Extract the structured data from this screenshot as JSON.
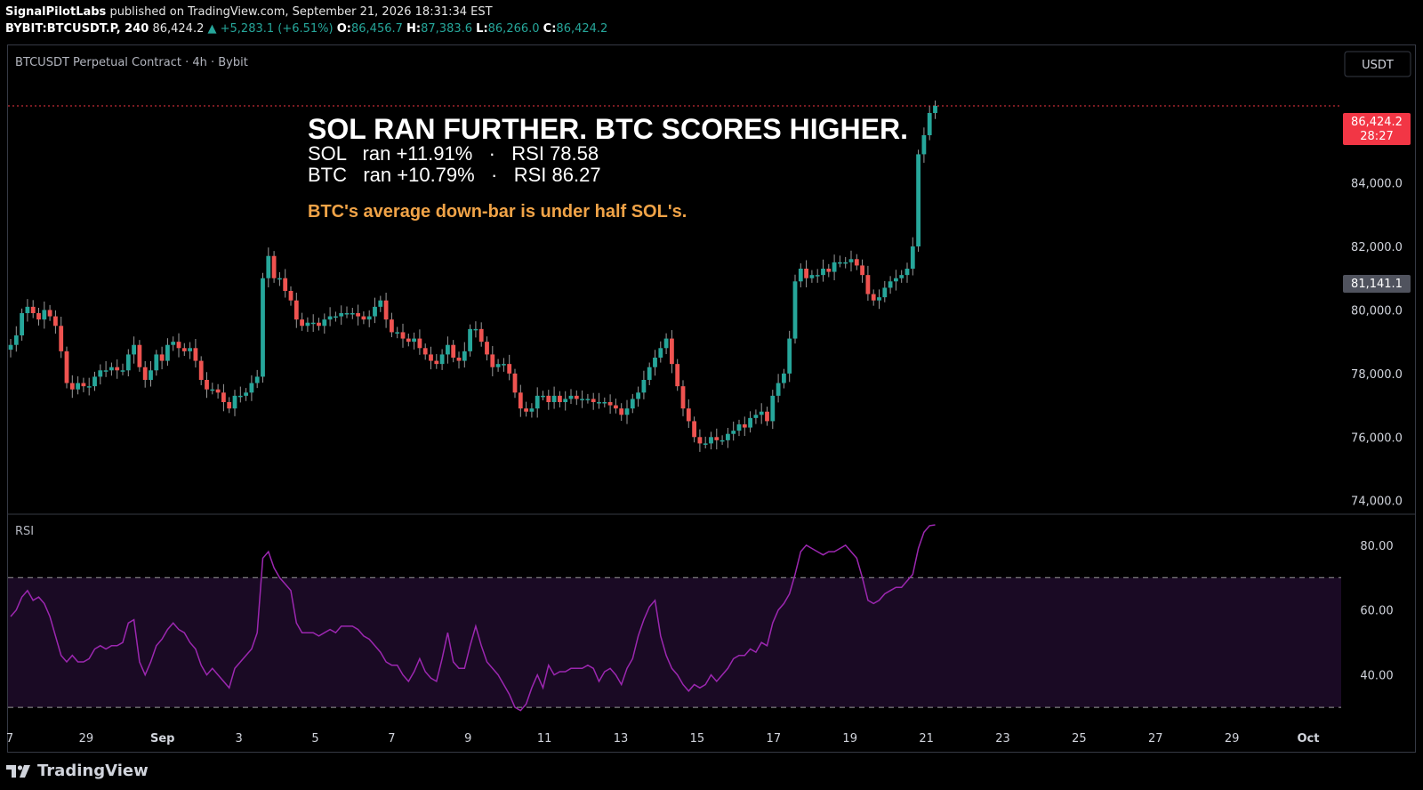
{
  "header": {
    "publisher": "SignalPilotLabs",
    "published_text": "published on TradingView.com, September 21, 2026 18:31:34 EST",
    "symbol": "BYBIT:BTCUSDT.P, 240",
    "last": "86,424.2",
    "change": "▲ +5,283.1 (+6.51%)",
    "o_label": "O:",
    "o": "86,456.7",
    "h_label": "H:",
    "h": "87,383.6",
    "l_label": "L:",
    "l": "86,266.0",
    "c_label": "C:",
    "c": "86,424.2"
  },
  "pane": {
    "legend": "BTCUSDT Perpetual Contract · 4h · Bybit",
    "currency_button": "USDT",
    "rsi_label": "RSI"
  },
  "annotation": {
    "headline": "SOL RAN FURTHER. BTC SCORES HIGHER.",
    "line1": "SOL   ran +11.91%   ·   RSI 78.58",
    "line2": "BTC   ran +10.79%   ·   RSI 86.27",
    "note": "BTC's average down-bar is under half SOL's."
  },
  "price_tags": {
    "last_price": "86,424.2",
    "countdown": "28:27",
    "prev_close": "81,141.1"
  },
  "footer": {
    "brand": "TradingView"
  },
  "chart_data": [
    {
      "type": "candlestick",
      "title": "BTCUSDT Perpetual Contract · 4h · Bybit",
      "ylim": [
        73600,
        88300
      ],
      "y_ticks": [
        74000,
        76000,
        78000,
        80000,
        82000,
        84000
      ],
      "y_tick_labels": [
        "74,000.0",
        "76,000.0",
        "78,000.0",
        "80,000.0",
        "82,000.0",
        "84,000.0"
      ],
      "x_tick_labels": [
        "7",
        "29",
        "Sep",
        "3",
        "5",
        "7",
        "9",
        "11",
        "13",
        "15",
        "17",
        "19",
        "21",
        "23",
        "25",
        "27",
        "29",
        "Oct"
      ],
      "close_series": [
        78900,
        79200,
        79900,
        80100,
        79900,
        79700,
        80000,
        79800,
        79500,
        78700,
        77700,
        77500,
        77700,
        77600,
        77600,
        77900,
        78100,
        78100,
        78200,
        78100,
        78100,
        78600,
        78900,
        78200,
        77800,
        78100,
        78600,
        78400,
        78900,
        79000,
        78800,
        78700,
        78800,
        78400,
        77800,
        77500,
        77500,
        77400,
        77100,
        76900,
        77300,
        77300,
        77400,
        77700,
        77900,
        81000,
        81700,
        81000,
        81000,
        80600,
        80300,
        79700,
        79500,
        79600,
        79600,
        79500,
        79700,
        79800,
        79800,
        79900,
        79900,
        79900,
        79800,
        79700,
        79800,
        80100,
        80300,
        79700,
        79300,
        79300,
        79100,
        79000,
        79100,
        78800,
        78600,
        78400,
        78300,
        78600,
        78900,
        78500,
        78400,
        78700,
        79400,
        79400,
        79000,
        78600,
        78200,
        78300,
        78300,
        78000,
        77400,
        76900,
        76800,
        76900,
        77300,
        77300,
        77100,
        77300,
        77100,
        77200,
        77300,
        77200,
        77200,
        77200,
        77100,
        77100,
        77100,
        77000,
        76900,
        76700,
        76900,
        77200,
        77400,
        77800,
        78200,
        78500,
        78800,
        79100,
        78300,
        77600,
        76900,
        76500,
        76000,
        75800,
        75800,
        76000,
        75900,
        75900,
        76100,
        76200,
        76400,
        76300,
        76600,
        76700,
        76800,
        76500,
        77300,
        77700,
        78000,
        79100,
        80900,
        81300,
        81000,
        81100,
        81100,
        81300,
        81200,
        81500,
        81500,
        81500,
        81600,
        81400,
        81100,
        80500,
        80300,
        80400,
        80700,
        80900,
        81000,
        81100,
        81300,
        82000,
        84900,
        85500,
        86200,
        86424.2
      ],
      "last_price": 86424.2
    },
    {
      "type": "line",
      "title": "RSI",
      "ylim": [
        27,
        89
      ],
      "y_ticks": [
        40,
        60,
        80
      ],
      "y_tick_labels": [
        "40.00",
        "60.00",
        "80.00"
      ],
      "bands": [
        30,
        70
      ],
      "values": [
        58,
        60,
        64,
        66,
        63,
        64,
        62,
        58,
        52,
        46,
        44,
        46,
        44,
        44,
        45,
        48,
        49,
        48,
        49,
        49,
        50,
        56,
        57,
        44,
        40,
        44,
        49,
        51,
        54,
        56,
        54,
        53,
        50,
        48,
        43,
        40,
        42,
        40,
        38,
        36,
        42,
        44,
        46,
        48,
        53,
        76,
        78,
        73,
        70,
        68,
        66,
        56,
        53,
        53,
        53,
        52,
        53,
        54,
        53,
        55,
        55,
        55,
        54,
        52,
        51,
        49,
        47,
        44,
        43,
        43,
        40,
        38,
        41,
        45,
        41,
        39,
        38,
        45,
        53,
        44,
        42,
        42,
        49,
        55,
        49,
        44,
        42,
        40,
        37,
        34,
        30,
        29,
        31,
        36,
        40,
        36,
        43,
        40,
        41,
        41,
        42,
        42,
        42,
        43,
        42,
        38,
        41,
        42,
        40,
        37,
        42,
        45,
        52,
        57,
        61,
        63,
        52,
        46,
        42,
        40,
        37,
        35,
        37,
        36,
        37,
        40,
        38,
        40,
        42,
        45,
        46,
        46,
        48,
        47,
        50,
        49,
        56,
        60,
        62,
        65,
        71,
        78,
        80,
        79,
        78,
        77,
        78,
        78,
        79,
        80,
        78,
        76,
        70,
        63,
        62,
        63,
        65,
        66,
        67,
        67,
        69,
        71,
        79,
        84,
        86,
        86.27
      ]
    }
  ],
  "colors": {
    "up": "#26a69a",
    "down": "#ef5350",
    "rsi_line": "#9c27b0",
    "rsi_band": "#1a0a24",
    "last_price_tag": "#f23645",
    "accent_note": "#f0a347"
  }
}
